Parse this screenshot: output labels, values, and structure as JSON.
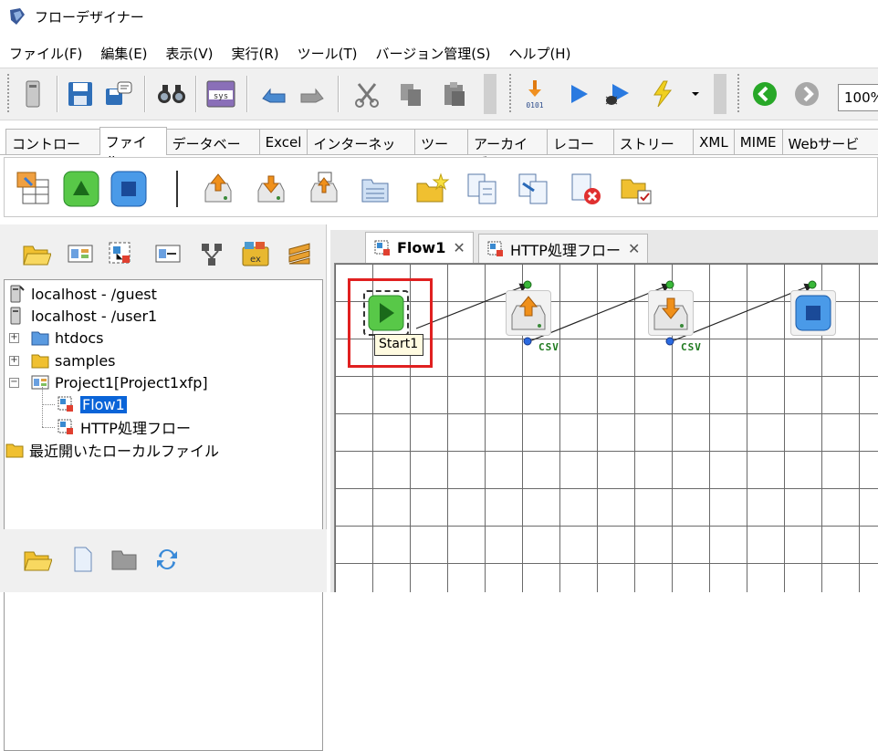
{
  "window": {
    "title": "フローデザイナー"
  },
  "menu": {
    "items": [
      "ファイル(F)",
      "編集(E)",
      "表示(V)",
      "実行(R)",
      "ツール(T)",
      "バージョン管理(S)",
      "ヘルプ(H)"
    ]
  },
  "toolbar": {
    "zoom_value": "100%"
  },
  "palette_tabs": {
    "items": [
      "コントロール",
      "ファイル",
      "データベース",
      "Excel",
      "インターネット",
      "ツール",
      "アーカイブ",
      "レコード",
      "ストリーム",
      "XML",
      "MIME",
      "Webサービス"
    ],
    "active": "ファイル"
  },
  "tree": {
    "items": [
      {
        "label": "localhost - /guest"
      },
      {
        "label": "localhost - /user1"
      },
      {
        "label": "htdocs"
      },
      {
        "label": "samples"
      },
      {
        "label": "Project1[Project1xfp]"
      },
      {
        "label": "Flow1"
      },
      {
        "label": "HTTP処理フロー"
      },
      {
        "label": "最近開いたローカルファイル"
      }
    ]
  },
  "editor": {
    "tabs": [
      {
        "label": "Flow1"
      },
      {
        "label": "HTTP処理フロー"
      }
    ],
    "close_glyph": "✕",
    "tooltip": "Start1",
    "csv_label_1": "CSV",
    "csv_label_2": "CSV"
  },
  "colors": {
    "highlight": "#e02020",
    "selection": "#0a64d8",
    "start_green": "#3cb83c",
    "end_blue": "#2f7fd8",
    "csv_green": "#1f7a1f"
  }
}
